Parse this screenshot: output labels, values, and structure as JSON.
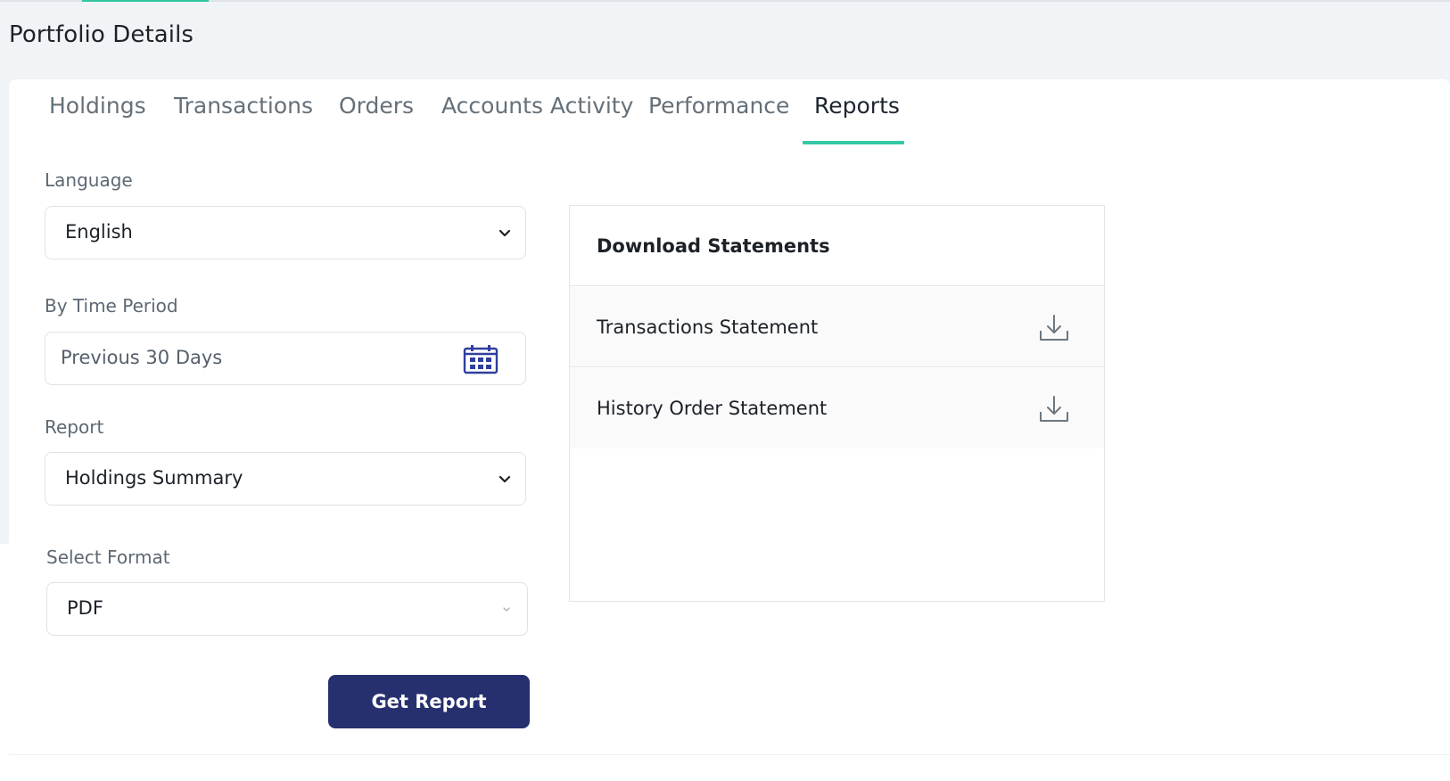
{
  "page": {
    "title": "Portfolio Details"
  },
  "tabs": [
    {
      "label": "Holdings",
      "active": false
    },
    {
      "label": "Transactions",
      "active": false
    },
    {
      "label": "Orders",
      "active": false
    },
    {
      "label": "Accounts Activity",
      "active": false
    },
    {
      "label": "Performance",
      "active": false
    },
    {
      "label": "Reports",
      "active": true
    }
  ],
  "form": {
    "language": {
      "label": "Language",
      "value": "English"
    },
    "time_period": {
      "label": "By Time Period",
      "value": "Previous 30 Days"
    },
    "report": {
      "label": "Report",
      "value": "Holdings Summary"
    },
    "format": {
      "label": "Select Format",
      "value": "PDF"
    },
    "submit_label": "Get Report"
  },
  "statements": {
    "title": "Download Statements",
    "items": [
      {
        "label": "Transactions Statement",
        "icon": "download-icon"
      },
      {
        "label": "History Order Statement",
        "icon": "download-icon"
      }
    ]
  },
  "colors": {
    "accent": "#34c8a6",
    "primary_button": "#27306e",
    "calendar_icon": "#2f3f9e",
    "background": "#f1f4f7"
  }
}
